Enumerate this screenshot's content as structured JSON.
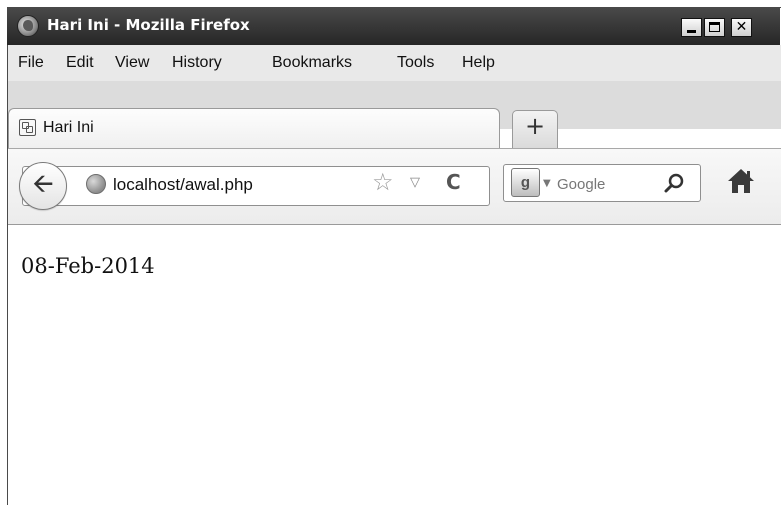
{
  "window": {
    "title": "Hari Ini - Mozilla Firefox",
    "controls": {
      "minimize": "minimize-icon",
      "maximize": "maximize-icon",
      "close": "✕"
    }
  },
  "menu": {
    "items": [
      {
        "label": "File"
      },
      {
        "label": "Edit"
      },
      {
        "label": "View"
      },
      {
        "label": "History"
      },
      {
        "label": "Bookmarks"
      },
      {
        "label": "Tools"
      },
      {
        "label": "Help"
      }
    ]
  },
  "tabs": [
    {
      "label": "Hari Ini",
      "icon": "page-icon",
      "active": true
    }
  ],
  "new_tab_label": "+",
  "navigation": {
    "back_icon": "back-arrow-icon",
    "url": "localhost/awal.php",
    "search": {
      "engine": "Google",
      "placeholder": "Google"
    }
  },
  "page": {
    "text": "08-Feb-2014"
  },
  "colors": {
    "titlebar": "#2e2e2e",
    "menubar": "#e9e9e9",
    "tabstrip": "#dcdcdc",
    "content": "#ffffff"
  }
}
